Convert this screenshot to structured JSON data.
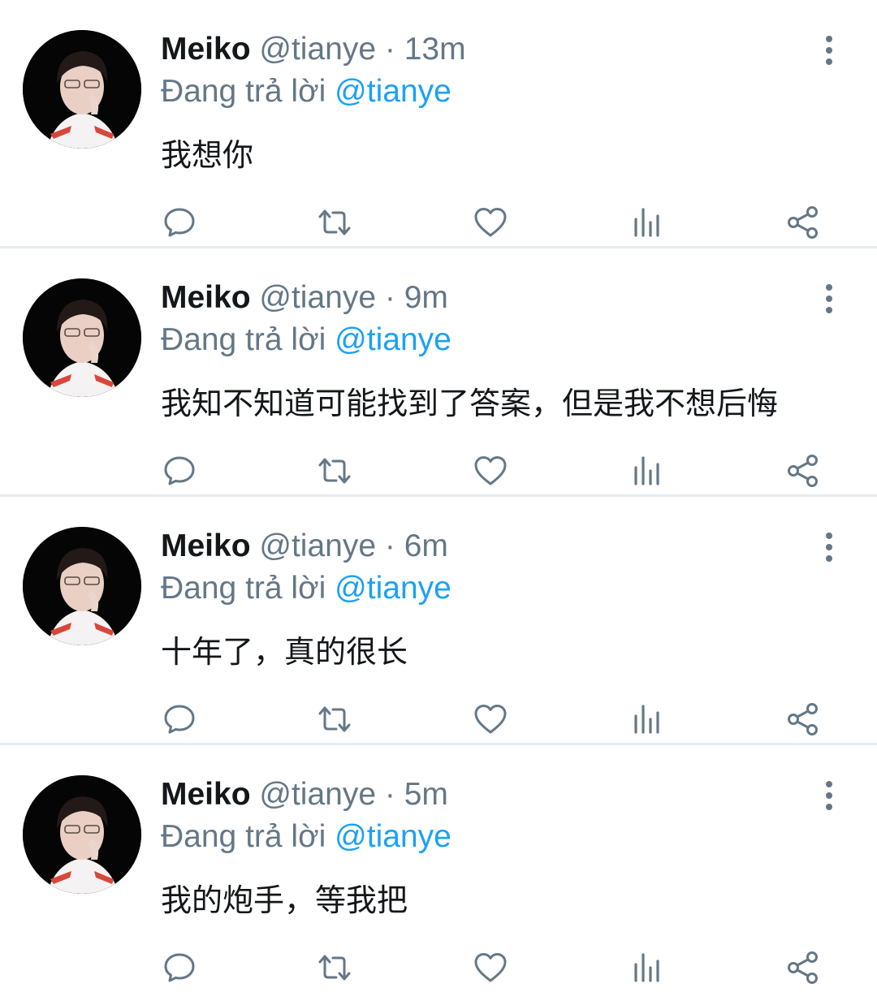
{
  "tweets": [
    {
      "name": "Meiko",
      "handle": "@tianye",
      "separator": "·",
      "time": "13m",
      "reply_prefix": "Đang trả lời",
      "reply_to": "@tianye",
      "text": "我想你"
    },
    {
      "name": "Meiko",
      "handle": "@tianye",
      "separator": "·",
      "time": "9m",
      "reply_prefix": "Đang trả lời",
      "reply_to": "@tianye",
      "text": "我知不知道可能找到了答案，但是我不想后悔"
    },
    {
      "name": "Meiko",
      "handle": "@tianye",
      "separator": "·",
      "time": "6m",
      "reply_prefix": "Đang trả lời",
      "reply_to": "@tianye",
      "text": "十年了，真的很长"
    },
    {
      "name": "Meiko",
      "handle": "@tianye",
      "separator": "·",
      "time": "5m",
      "reply_prefix": "Đang trả lời",
      "reply_to": "@tianye",
      "text": "我的炮手，等我把"
    }
  ],
  "icons": {
    "reply": "speech-bubble-icon",
    "retweet": "retweet-arrows-icon",
    "like": "heart-icon",
    "analytics": "bar-chart-icon",
    "share": "share-nodes-icon",
    "more": "vertical-dots-icon"
  },
  "colors": {
    "name": "#14171a",
    "muted": "#657786",
    "mention": "#1da1f2",
    "divider": "#e6ecf0"
  }
}
